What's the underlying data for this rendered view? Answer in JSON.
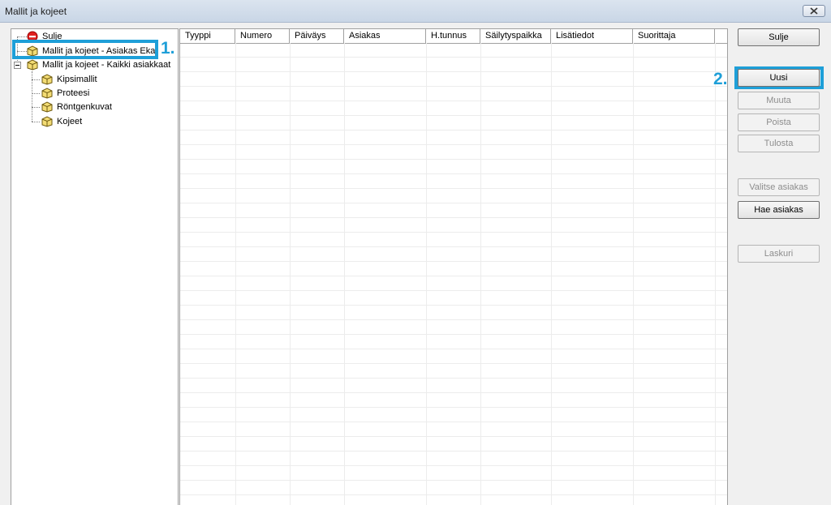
{
  "window": {
    "title": "Mallit ja kojeet"
  },
  "tree": {
    "items": [
      {
        "label": "Sulje",
        "icon": "no-entry-icon"
      },
      {
        "label": "Mallit ja kojeet - Asiakas Eka",
        "icon": "package-icon"
      },
      {
        "label": "Mallit ja kojeet - Kaikki asiakkaat",
        "icon": "package-icon"
      },
      {
        "label": "Kipsimallit",
        "icon": "package-icon"
      },
      {
        "label": "Proteesi",
        "icon": "package-icon"
      },
      {
        "label": "Röntgenkuvat",
        "icon": "package-icon"
      },
      {
        "label": "Kojeet",
        "icon": "package-icon"
      }
    ]
  },
  "grid": {
    "columns": [
      "Tyyppi",
      "Numero",
      "Päiväys",
      "Asiakas",
      "H.tunnus",
      "Säilytyspaikka",
      "Lisätiedot",
      "Suorittaja"
    ],
    "rows": []
  },
  "buttons": {
    "close": "Sulje",
    "new": "Uusi",
    "edit": "Muuta",
    "delete": "Poista",
    "print": "Tulosta",
    "select_customer": "Valitse asiakas",
    "find_customer": "Hae asiakas",
    "calculator": "Laskuri"
  },
  "callouts": {
    "one": "1.",
    "two": "2."
  },
  "colors": {
    "callout": "#1e9fd8",
    "disabled_text": "#8d8d8d"
  }
}
